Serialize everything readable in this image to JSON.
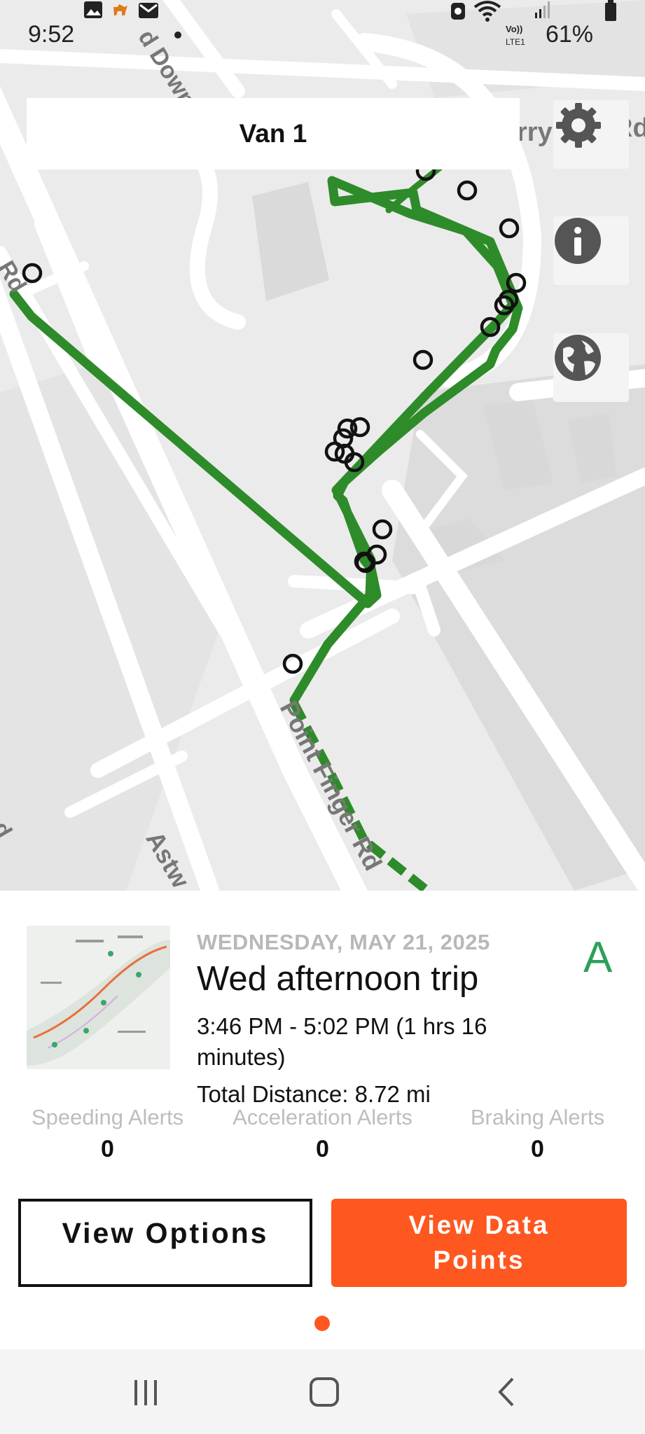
{
  "status_bar": {
    "time": "9:52",
    "battery": "61%",
    "icons": [
      "image-icon",
      "dog-icon",
      "mail-icon",
      "dot-icon",
      "alarm-icon",
      "wifi-icon",
      "volte-icon",
      "signal-icon",
      "battery-icon"
    ]
  },
  "map": {
    "vehicle_title": "Van 1",
    "street_labels": [
      "d Down Ln",
      "rry",
      "Rd",
      "Rd",
      "Point Finger Rd",
      "Astw",
      "d"
    ],
    "route_color": "#2e8b2a",
    "buttons": [
      "settings-icon",
      "info-icon",
      "globe-icon"
    ]
  },
  "trip": {
    "date": "WEDNESDAY, MAY 21, 2025",
    "title": "Wed afternoon trip",
    "time_range": "3:46 PM - 5:02 PM (1 hrs 16 minutes)",
    "total_distance": "Total Distance: 8.72 mi",
    "grade": "A",
    "grade_color": "#2ca05a"
  },
  "alerts": [
    {
      "label": "Speeding Alerts",
      "value": "0"
    },
    {
      "label": "Acceleration Alerts",
      "value": "0"
    },
    {
      "label": "Braking Alerts",
      "value": "0"
    }
  ],
  "actions": {
    "view_options": "View Options",
    "view_data_points": "View Data Points",
    "accent": "#fe5720"
  },
  "nav": {
    "icons": [
      "recent-apps-icon",
      "home-icon",
      "back-icon"
    ]
  }
}
